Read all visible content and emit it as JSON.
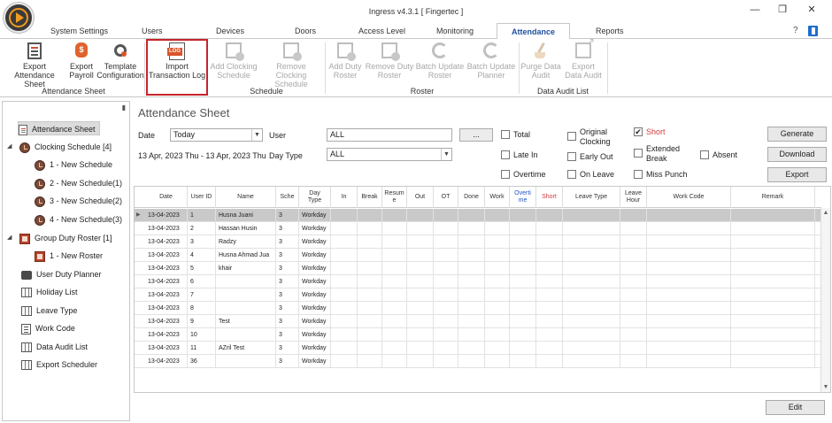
{
  "window": {
    "title": "Ingress v4.3.1 [ Fingertec ]",
    "minimize": "—",
    "restore": "❐",
    "close": "✕"
  },
  "tabs": [
    {
      "label": "System Settings"
    },
    {
      "label": "Users"
    },
    {
      "label": "Devices"
    },
    {
      "label": "Doors"
    },
    {
      "label": "Access Level"
    },
    {
      "label": "Monitoring"
    },
    {
      "label": "Attendance"
    },
    {
      "label": "Reports"
    }
  ],
  "active_tab": "Attendance",
  "ribbon": {
    "export_attendance_sheet": "Export\nAttendance Sheet",
    "export_payroll": "Export\nPayroll",
    "template_configuration": "Template\nConfiguration",
    "import_transaction_log": "Import\nTransaction Log",
    "log_icon_text": "LOG",
    "add_clocking_schedule": "Add Clocking\nSchedule",
    "remove_clocking_schedule": "Remove Clocking\nSchedule",
    "add_duty_roster": "Add Duty\nRoster",
    "remove_duty_roster": "Remove Duty\nRoster",
    "batch_update_roster": "Batch Update\nRoster",
    "batch_update_planner": "Batch Update\nPlanner",
    "purge_data_audit": "Purge Data\nAudit",
    "export_data_audit": "Export\nData Audit",
    "groups": {
      "attendance_sheet": "Attendance Sheet",
      "schedule": "Schedule",
      "roster": "Roster",
      "data_audit_list": "Data Audit List"
    }
  },
  "sidebar": {
    "items": [
      {
        "label": "Attendance Sheet"
      },
      {
        "label": "Clocking Schedule [4]"
      },
      {
        "label": "1 - New Schedule"
      },
      {
        "label": "2 - New Schedule(1)"
      },
      {
        "label": "3 - New Schedule(2)"
      },
      {
        "label": "4 - New Schedule(3)"
      },
      {
        "label": "Group Duty Roster [1]"
      },
      {
        "label": "1 - New Roster"
      },
      {
        "label": "User Duty Planner"
      },
      {
        "label": "Holiday List"
      },
      {
        "label": "Leave Type"
      },
      {
        "label": "Work Code"
      },
      {
        "label": "Data Audit List"
      },
      {
        "label": "Export Scheduler"
      }
    ]
  },
  "main": {
    "title": "Attendance Sheet",
    "date_label": "Date",
    "date_value": "Today",
    "date_range": "13 Apr, 2023 Thu - 13 Apr, 2023 Thu",
    "user_label": "User",
    "user_value": "ALL",
    "browse_button": "...",
    "day_type_label": "Day Type",
    "day_type_value": "ALL",
    "filters": {
      "total": "Total",
      "late_in": "Late In",
      "overtime": "Overtime",
      "original_clocking": "Original\nClocking",
      "early_out": "Early Out",
      "on_leave": "On Leave",
      "short": "Short",
      "short_checked": "✔",
      "extended_break": "Extended\nBreak",
      "miss_punch": "Miss Punch",
      "absent": "Absent"
    },
    "generate_button": "Generate",
    "download_button": "Download",
    "export_button": "Export",
    "edit_button": "Edit"
  },
  "table": {
    "columns": [
      "Date",
      "User ID",
      "Name",
      "Sche",
      "Day\nType",
      "In",
      "Break",
      "Resum\ne",
      "Out",
      "OT",
      "Done",
      "Work",
      "Overti\nme",
      "Short",
      "Leave Type",
      "Leave\nHour",
      "Work Code",
      "Remark"
    ],
    "rows": [
      {
        "date": "13-04-2023",
        "user_id": "1",
        "name": "Husna Juani",
        "sche": "3",
        "day_type": "Workday"
      },
      {
        "date": "13-04-2023",
        "user_id": "2",
        "name": "Hassan Husin",
        "sche": "3",
        "day_type": "Workday"
      },
      {
        "date": "13-04-2023",
        "user_id": "3",
        "name": "Radzy",
        "sche": "3",
        "day_type": "Workday"
      },
      {
        "date": "13-04-2023",
        "user_id": "4",
        "name": "Husna Ahmad Jua",
        "sche": "3",
        "day_type": "Workday"
      },
      {
        "date": "13-04-2023",
        "user_id": "5",
        "name": "khair",
        "sche": "3",
        "day_type": "Workday"
      },
      {
        "date": "13-04-2023",
        "user_id": "6",
        "name": "",
        "sche": "3",
        "day_type": "Workday"
      },
      {
        "date": "13-04-2023",
        "user_id": "7",
        "name": "",
        "sche": "3",
        "day_type": "Workday"
      },
      {
        "date": "13-04-2023",
        "user_id": "8",
        "name": "",
        "sche": "3",
        "day_type": "Workday"
      },
      {
        "date": "13-04-2023",
        "user_id": "9",
        "name": "Test",
        "sche": "3",
        "day_type": "Workday"
      },
      {
        "date": "13-04-2023",
        "user_id": "10",
        "name": "",
        "sche": "3",
        "day_type": "Workday"
      },
      {
        "date": "13-04-2023",
        "user_id": "11",
        "name": "AZril Test",
        "sche": "3",
        "day_type": "Workday"
      },
      {
        "date": "13-04-2023",
        "user_id": "36",
        "name": "",
        "sche": "3",
        "day_type": "Workday"
      }
    ],
    "selected_row": 0
  },
  "colors": {
    "accent_blue": "#1f4f9f",
    "highlight_red": "#c8242b",
    "brand_orange": "#f29b21"
  }
}
